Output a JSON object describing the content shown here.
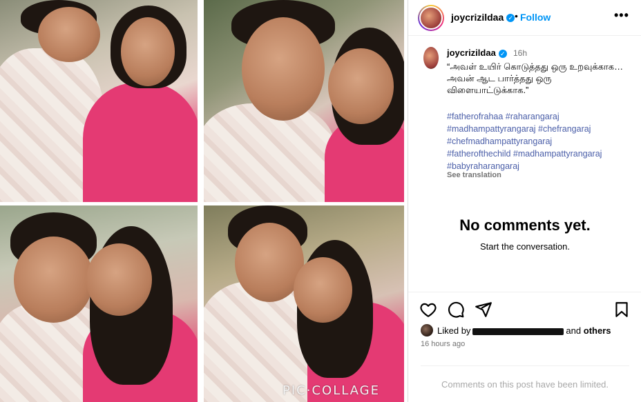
{
  "post": {
    "username": "joycrizildaa",
    "follow_label": "Follow",
    "separator": "•",
    "more_label": "•••",
    "caption": {
      "username": "joycrizildaa",
      "time": "16h",
      "text": "“அவள் உயிர் கொடுத்தது ஒரு உறவுக்காக… அவன் ஆட பார்த்தது ஒரு விளையாட்டுக்காக.”",
      "hashtags": [
        "#fatherofrahaa #raharangaraj",
        "#madhampattyrangaraj #chefrangaraj",
        "#chefmadhampattyrangaraj",
        "#fatherofthechild #madhampattyrangaraj",
        "#babyraharangaraj"
      ],
      "see_translation": "See translation"
    },
    "comments": {
      "empty_title": "No comments yet.",
      "empty_subtitle": "Start the conversation."
    },
    "likes": {
      "prefix": "Liked by",
      "connector": "and",
      "others": "others"
    },
    "time_ago": "16 hours ago",
    "comments_limited": "Comments on this post have been limited.",
    "watermark": "PIC·COLLAGE"
  },
  "icons": {
    "verified": "verified-badge-icon",
    "like": "heart-icon",
    "comment": "comment-bubble-icon",
    "share": "paper-plane-icon",
    "save": "bookmark-icon"
  },
  "colors": {
    "link_blue": "#0095f6",
    "hashtag": "#4a5ea8",
    "muted": "#737373",
    "shirt_pink": "#e43a73"
  }
}
